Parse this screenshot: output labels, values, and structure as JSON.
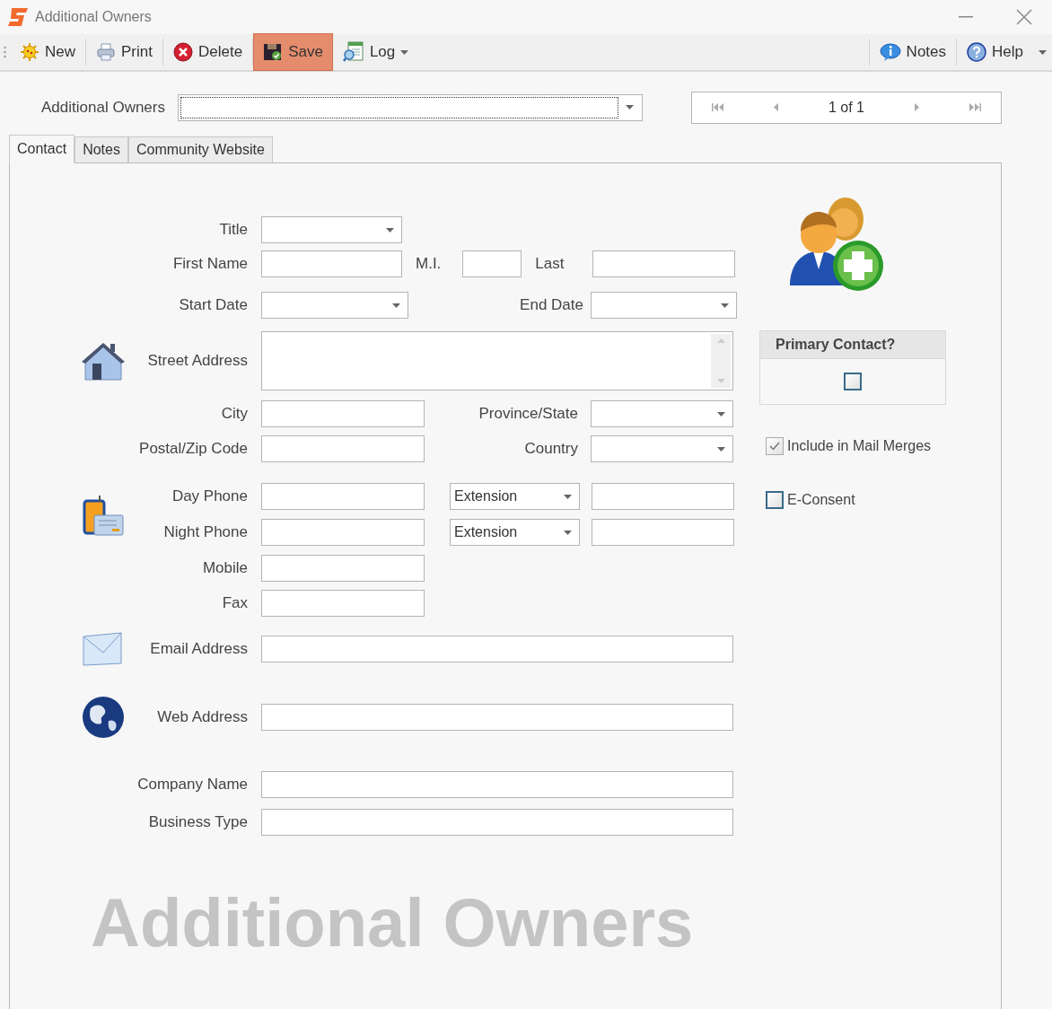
{
  "window": {
    "title": "Additional Owners"
  },
  "toolbar": {
    "left": [
      {
        "kind": "new",
        "label": "New",
        "active": false
      },
      {
        "kind": "print",
        "label": "Print",
        "active": false
      },
      {
        "kind": "delete",
        "label": "Delete",
        "active": false
      },
      {
        "kind": "save",
        "label": "Save",
        "active": true
      },
      {
        "kind": "log",
        "label": "Log",
        "active": false,
        "has_menu": true
      }
    ],
    "right": [
      {
        "kind": "notes",
        "label": "Notes",
        "active": false
      },
      {
        "kind": "help",
        "label": "Help",
        "active": false
      }
    ]
  },
  "record_selector": {
    "label": "Additional Owners"
  },
  "navigator": {
    "position": "1 of 1"
  },
  "tabs": [
    {
      "label": "Contact",
      "selected": true
    },
    {
      "label": "Notes",
      "selected": false
    },
    {
      "label": "Community Website",
      "selected": false
    }
  ],
  "contact": {
    "title": "Title",
    "first_name": "First Name",
    "mi": "M.I.",
    "last": "Last",
    "start_date": "Start Date",
    "end_date": "End Date",
    "street": "Street Address",
    "city": "City",
    "province": "Province/State",
    "postal": "Postal/Zip Code",
    "country": "Country",
    "day_phone": "Day Phone",
    "day_ext": "Extension",
    "night_phone": "Night Phone",
    "night_ext": "Extension",
    "mobile": "Mobile",
    "fax": "Fax",
    "email": "Email Address",
    "web": "Web Address",
    "company": "Company Name",
    "business": "Business Type"
  },
  "primary_contact": {
    "title": "Primary Contact?",
    "checked": false
  },
  "checkboxes": [
    {
      "label": "Include in Mail Merges",
      "checked": true
    },
    {
      "label": "E-Consent",
      "checked": false
    }
  ],
  "caption": "Additional Owners"
}
